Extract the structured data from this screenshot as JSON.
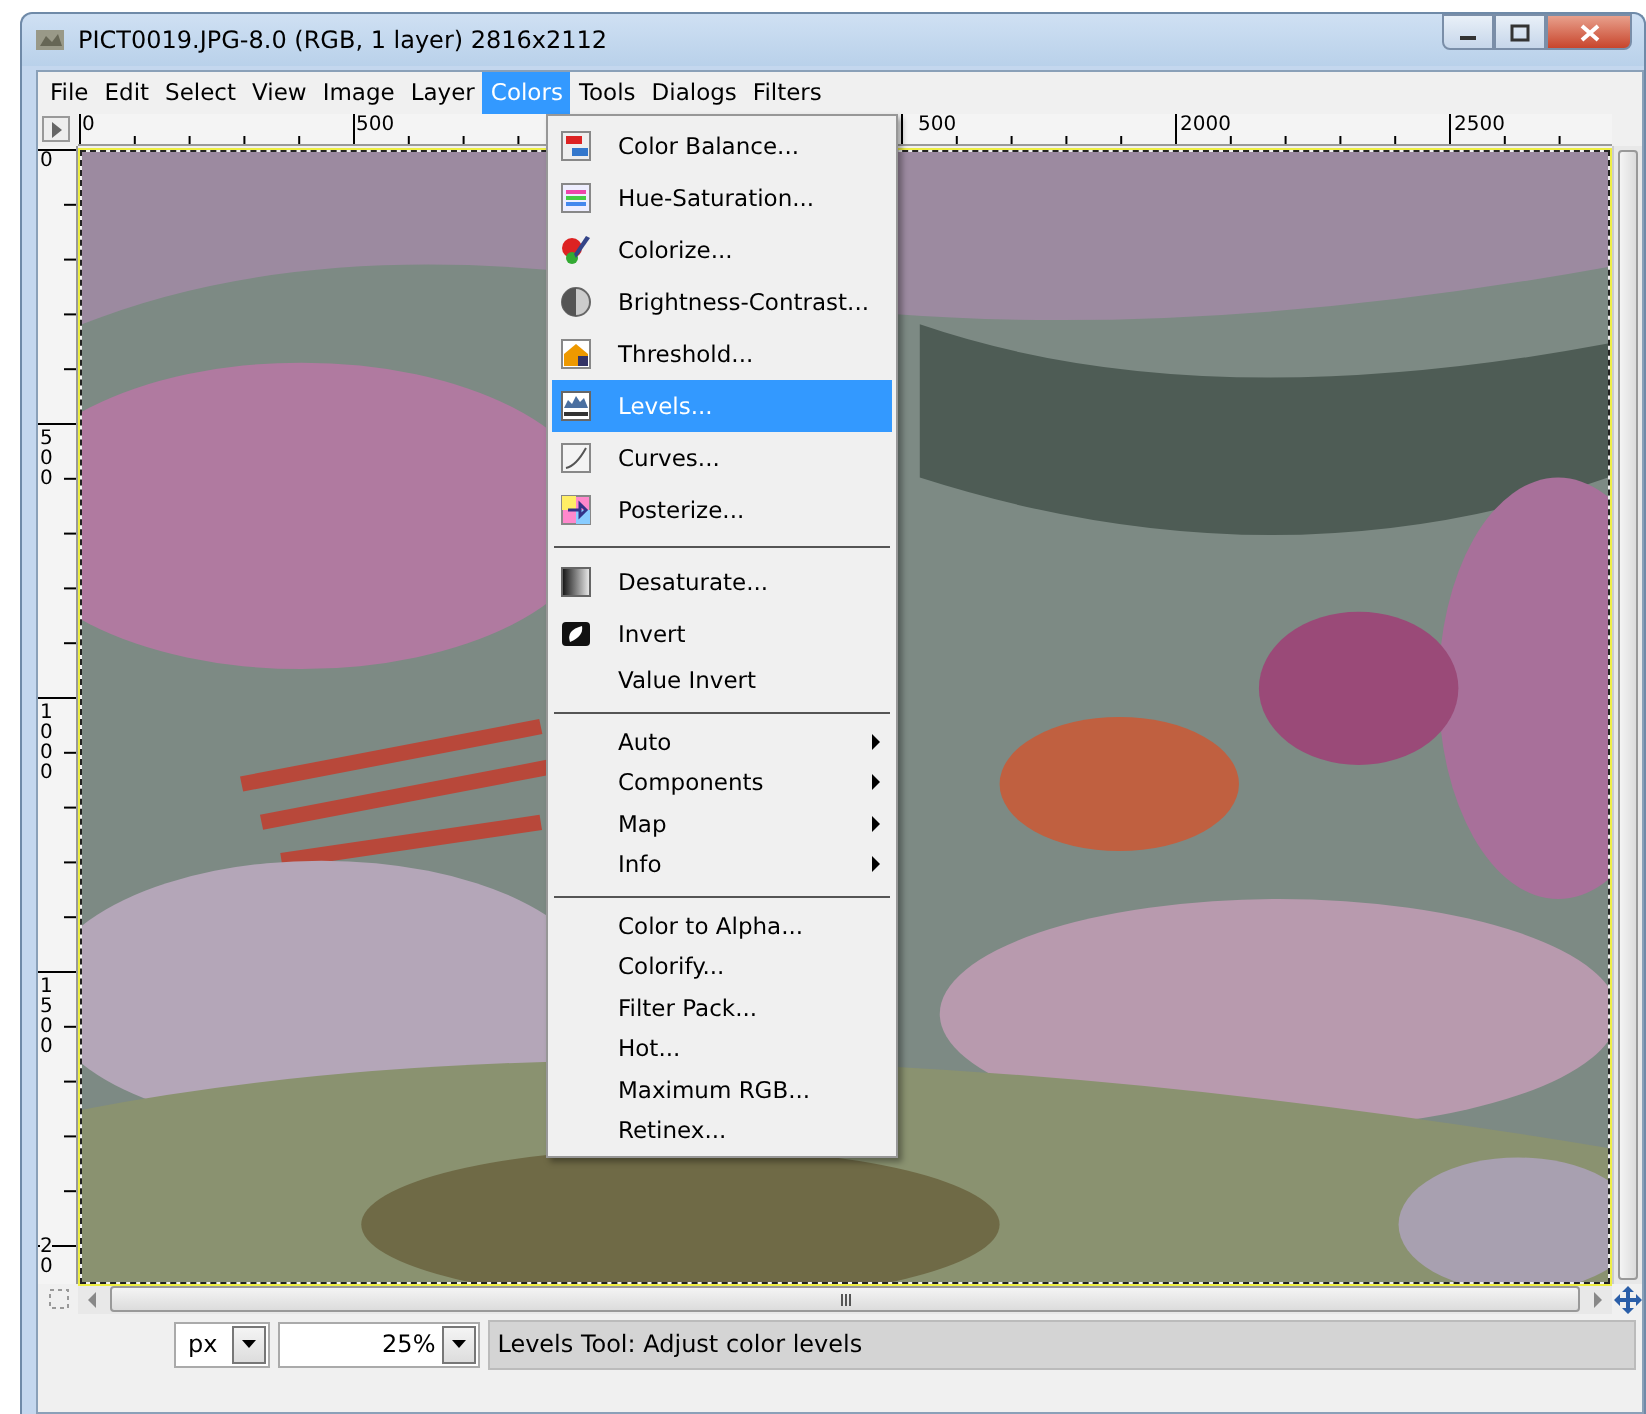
{
  "window": {
    "title": "PICT0019.JPG-8.0 (RGB, 1 layer) 2816x2112"
  },
  "menubar": [
    {
      "label": "File",
      "selected": false
    },
    {
      "label": "Edit",
      "selected": false
    },
    {
      "label": "Select",
      "selected": false
    },
    {
      "label": "View",
      "selected": false
    },
    {
      "label": "Image",
      "selected": false
    },
    {
      "label": "Layer",
      "selected": false
    },
    {
      "label": "Colors",
      "selected": true
    },
    {
      "label": "Tools",
      "selected": false
    },
    {
      "label": "Dialogs",
      "selected": false
    },
    {
      "label": "Filters",
      "selected": false
    }
  ],
  "rulers": {
    "horizontal": [
      "0",
      "500",
      "500",
      "2000",
      "2500"
    ],
    "vertical": [
      "0",
      "500",
      "1000",
      "1500",
      "20"
    ]
  },
  "menu": {
    "sections": [
      [
        {
          "label": "Color Balance...",
          "kind": "balance",
          "submenu": false,
          "selected": false
        },
        {
          "label": "Hue-Saturation...",
          "kind": "hue",
          "submenu": false,
          "selected": false
        },
        {
          "label": "Colorize...",
          "kind": "colorize",
          "submenu": false,
          "selected": false
        },
        {
          "label": "Brightness-Contrast...",
          "kind": "brightness",
          "submenu": false,
          "selected": false
        },
        {
          "label": "Threshold...",
          "kind": "threshold",
          "submenu": false,
          "selected": false
        },
        {
          "label": "Levels...",
          "kind": "levels",
          "submenu": false,
          "selected": true
        },
        {
          "label": "Curves...",
          "kind": "curves",
          "submenu": false,
          "selected": false
        },
        {
          "label": "Posterize...",
          "kind": "posterize",
          "submenu": false,
          "selected": false
        }
      ],
      [
        {
          "label": "Desaturate...",
          "kind": "desaturate",
          "submenu": false,
          "selected": false
        },
        {
          "label": "Invert",
          "kind": "invert",
          "submenu": false,
          "selected": false
        },
        {
          "label": "Value Invert",
          "submenu": false,
          "selected": false
        }
      ],
      [
        {
          "label": "Auto",
          "submenu": true,
          "selected": false
        },
        {
          "label": "Components",
          "submenu": true,
          "selected": false
        },
        {
          "label": "Map",
          "submenu": true,
          "selected": false
        },
        {
          "label": "Info",
          "submenu": true,
          "selected": false
        }
      ],
      [
        {
          "label": "Color to Alpha...",
          "submenu": false,
          "selected": false
        },
        {
          "label": "Colorify...",
          "submenu": false,
          "selected": false
        },
        {
          "label": "Filter Pack...",
          "submenu": false,
          "selected": false
        },
        {
          "label": "Hot...",
          "submenu": false,
          "selected": false
        },
        {
          "label": "Maximum RGB...",
          "submenu": false,
          "selected": false
        },
        {
          "label": "Retinex...",
          "submenu": false,
          "selected": false
        }
      ]
    ]
  },
  "status_bar": {
    "unit": "px",
    "zoom": "25%",
    "message": "Levels Tool: Adjust color levels"
  }
}
